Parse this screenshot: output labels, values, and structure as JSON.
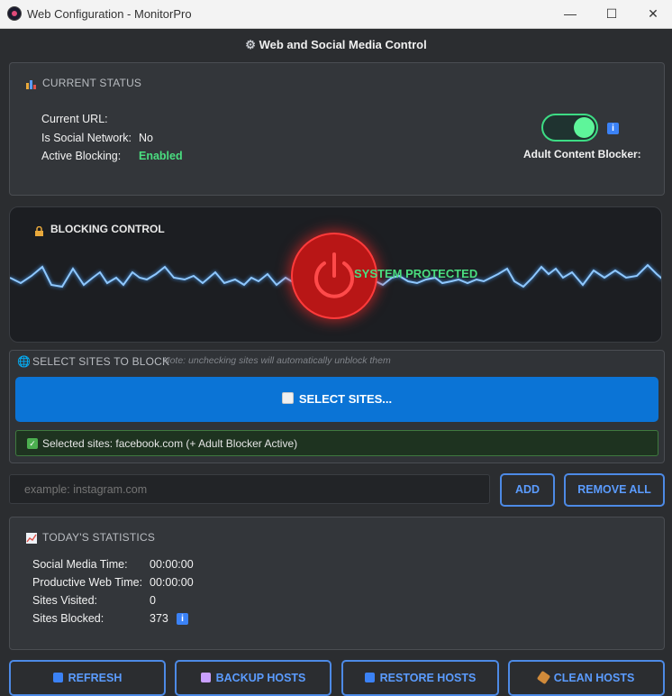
{
  "window": {
    "title": "Web Configuration - MonitorPro",
    "controls": {
      "minimize": "—",
      "maximize": "☐",
      "close": "✕"
    }
  },
  "header": {
    "icon": "gear-icon",
    "title": "Web and Social Media Control"
  },
  "status": {
    "title": "CURRENT STATUS",
    "current_url_label": "Current URL:",
    "current_url_value": "",
    "social_label": "Is Social Network:",
    "social_value": "No",
    "blocking_label": "Active Blocking:",
    "blocking_value": "Enabled",
    "adult_blocker_label": "Adult Content Blocker:",
    "adult_blocker_on": true,
    "info_glyph": "i"
  },
  "blocking": {
    "title": "BLOCKING CONTROL",
    "system_text": "SYSTEM PROTECTED"
  },
  "select_sites": {
    "title": "SELECT SITES TO BLOCK",
    "note": "Note: unchecking sites will automatically unblock them",
    "button_label": "SELECT SITES...",
    "selected_text": "Selected sites: facebook.com (+ Adult Blocker Active)"
  },
  "add_site": {
    "placeholder": "example: instagram.com",
    "add_label": "ADD",
    "remove_all_label": "REMOVE ALL"
  },
  "stats": {
    "title": "TODAY'S STATISTICS",
    "rows": [
      {
        "label": "Social Media Time:",
        "value": "00:00:00"
      },
      {
        "label": "Productive Web Time:",
        "value": "00:00:00"
      },
      {
        "label": "Sites Visited:",
        "value": "0"
      },
      {
        "label": "Sites Blocked:",
        "value": "373"
      }
    ]
  },
  "footer": {
    "refresh_label": "REFRESH",
    "backup_label": "BACKUP HOSTS",
    "restore_label": "RESTORE HOSTS",
    "clean_label": "CLEAN HOSTS"
  },
  "colors": {
    "accent_blue": "#0b74d6",
    "success_green": "#4ade80",
    "danger_red": "#b81616",
    "background": "#2b2d30"
  }
}
